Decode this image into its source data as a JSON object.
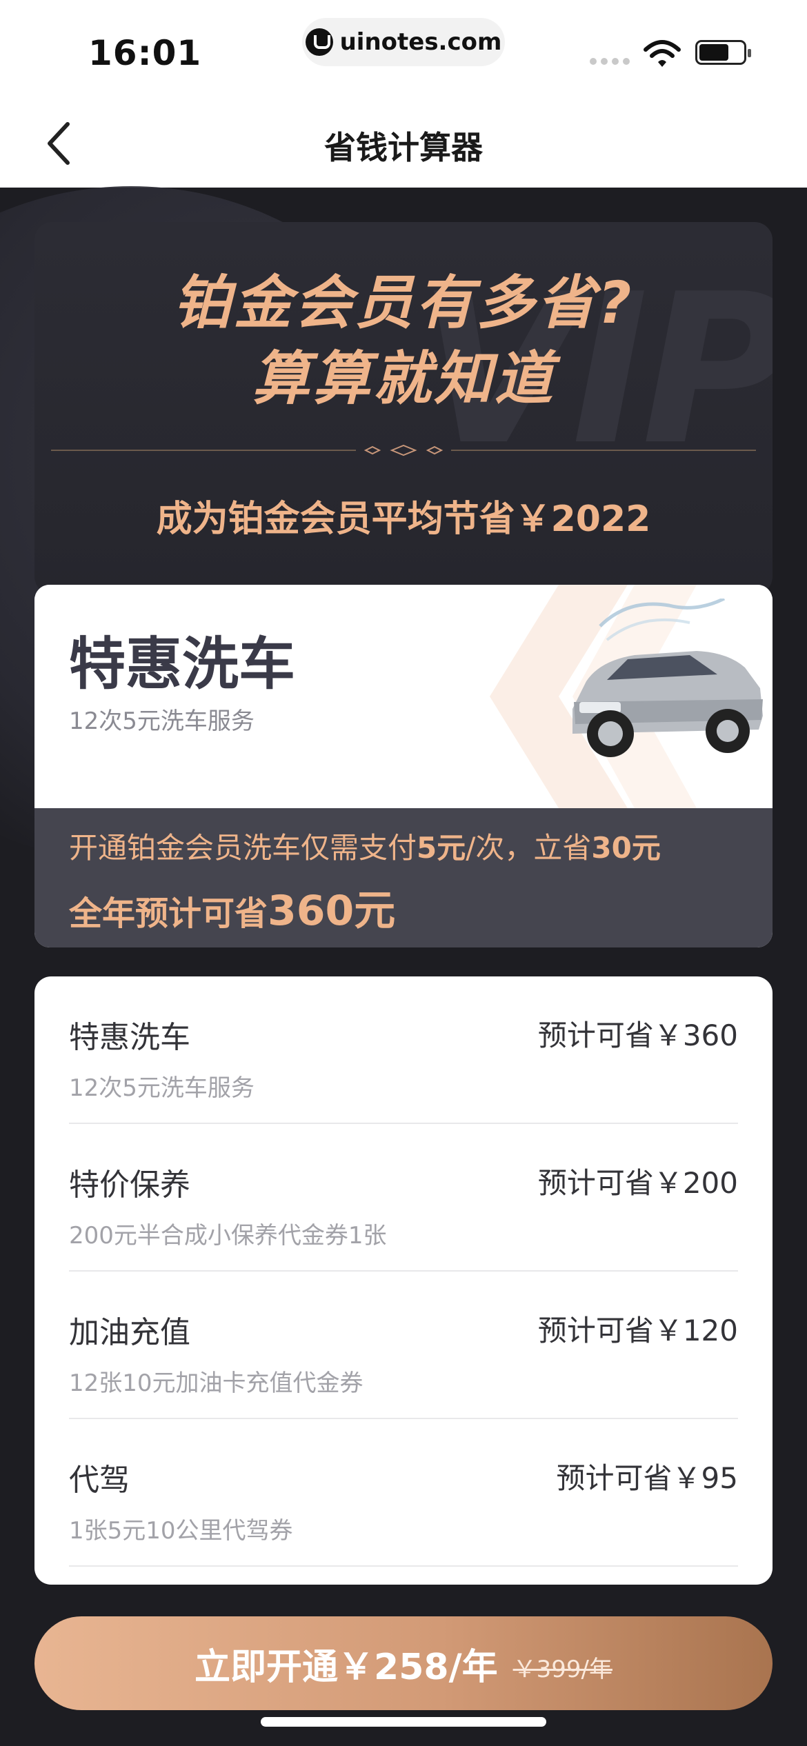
{
  "status_bar": {
    "time": "16:01",
    "url": "uinotes.com"
  },
  "nav": {
    "title": "省钱计算器"
  },
  "hero": {
    "line1": "铂金会员有多省?",
    "line2": "算算就知道",
    "subtitle": "成为铂金会员平均节省￥2022"
  },
  "wash": {
    "title": "特惠洗车",
    "desc": "12次5元洗车服务",
    "line1_a": "开通铂金会员洗车仅需支付",
    "line1_b": "5元",
    "line1_c": "/次，立省",
    "line1_d": "30元",
    "line2_a": "全年预计可省",
    "line2_b": "360元"
  },
  "items": [
    {
      "name": "特惠洗车",
      "save": "预计可省￥360",
      "desc": "12次5元洗车服务"
    },
    {
      "name": "特价保养",
      "save": "预计可省￥200",
      "desc": "200元半合成小保养代金券1张"
    },
    {
      "name": "加油充值",
      "save": "预计可省￥120",
      "desc": "12张10元加油卡充值代金券"
    },
    {
      "name": "代驾",
      "save": "预计可省￥95",
      "desc": "1张5元10公里代驾券"
    }
  ],
  "cta": {
    "label": "立即开通￥258/年",
    "original_price": "￥399/年"
  },
  "colors": {
    "gold": "#efb48a",
    "dark_bg": "#1d1d22",
    "card_bg": "#2c2c34",
    "band_bg": "#45454f"
  }
}
